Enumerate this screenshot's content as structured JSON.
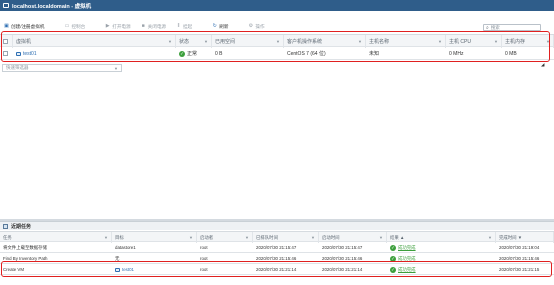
{
  "title_bar": {
    "title": "localhost.localdomain - 虚拟机"
  },
  "toolbar": {
    "create_label": "创建/注册虚拟机",
    "console_label": "控制台",
    "power_on_label": "打开电源",
    "power_off_label": "关闭电源",
    "suspend_label": "挂起",
    "refresh_label": "刷新",
    "actions_label": "操作"
  },
  "search": {
    "placeholder": "搜索"
  },
  "vm_grid": {
    "headers": [
      "虚拟机",
      "状态",
      "已用空间",
      "客户机操作系统",
      "主机名称",
      "主机 CPU",
      "主机内存"
    ],
    "rows": [
      {
        "name": "test01",
        "status": "正常",
        "used_space": "0 B",
        "guest_os": "CentOS 7 (64 位)",
        "host_name": "未知",
        "host_cpu": "0 MHz",
        "host_memory": "0 MB"
      }
    ]
  },
  "filter": {
    "placeholder": "快速筛选器"
  },
  "tasks_panel": {
    "title": "近期任务",
    "headers": [
      "任务",
      "目标",
      "启动者",
      "已排队时间",
      "启动时间",
      "结果 ▲",
      "完成时间 ▼"
    ],
    "rows": [
      {
        "task": "将文件上载至数据存储",
        "target": "datastore1",
        "initiator": "root",
        "queued": "2020/07/30 21:15:47",
        "started": "2020/07/30 21:15:47",
        "result": "成功完成",
        "completed": "2020/07/30 21:19:04"
      },
      {
        "task": "Find By Inventory Path",
        "target": "无",
        "initiator": "root",
        "queued": "2020/07/30 21:15:46",
        "started": "2020/07/30 21:15:46",
        "result": "成功完成",
        "completed": "2020/07/30 21:15:46"
      },
      {
        "task": "Create VM",
        "target": "test01",
        "initiator": "root",
        "queued": "2020/07/30 21:21:14",
        "started": "2020/07/30 21:21:14",
        "result": "成功完成",
        "completed": "2020/07/30 21:21:15"
      }
    ]
  },
  "colors": {
    "title_bar": "#2f5d8a",
    "highlight": "#e02020",
    "success": "#3c9f3c",
    "link": "#2e6fb3"
  }
}
